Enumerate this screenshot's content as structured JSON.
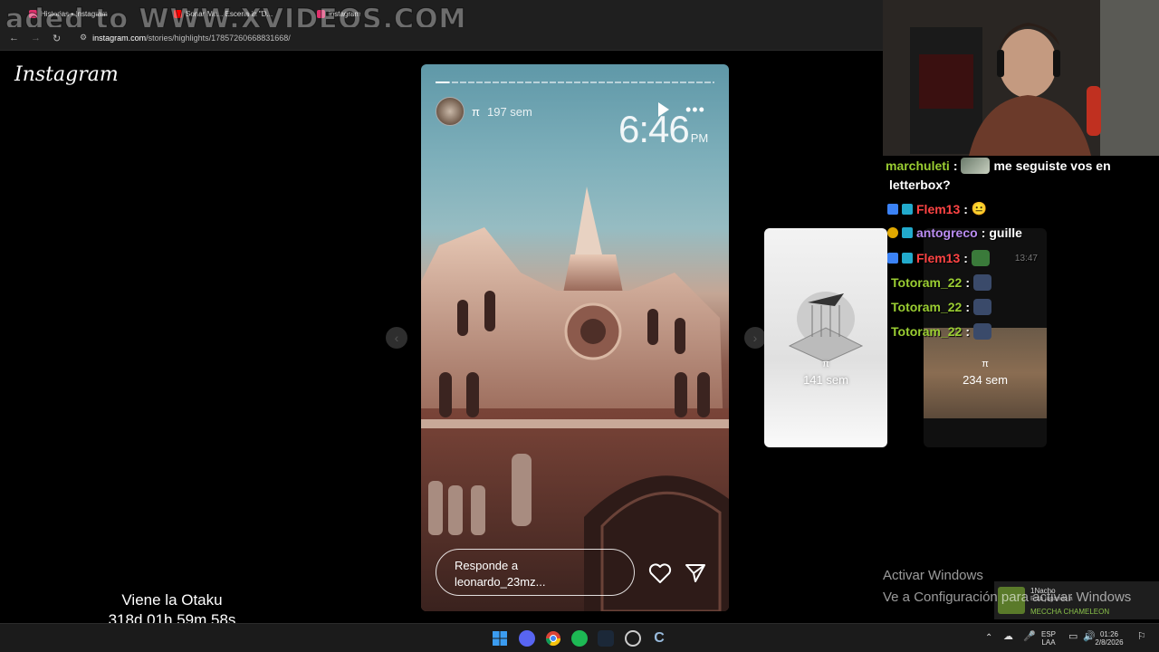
{
  "browser": {
    "tabs": [
      {
        "title": "Historias • Instagram",
        "color": "#e1306c"
      },
      {
        "title": "Sonar Mu... Escena in \"D...",
        "color": "#ff0000"
      },
      {
        "title": "instagram",
        "color": "#e1306c"
      }
    ],
    "watermark": "aded to WWW.XVIDEOS.COM",
    "url_host": "instagram.com",
    "url_path": "/stories/highlights/17857260668831668/"
  },
  "instagram": {
    "logo": "Instagram",
    "story": {
      "username": "π",
      "age": "197 sem",
      "clock_time": "6:46",
      "clock_ampm": "PM",
      "progress": 0.05,
      "reply_placeholder_line1": "Responde a",
      "reply_placeholder_line2": "leonardo_23mz..."
    },
    "side_stories": [
      {
        "username": "π",
        "age": "141 sem",
        "style": "light"
      },
      {
        "username": "π",
        "age": "234 sem",
        "style": "dark"
      }
    ]
  },
  "overlay": {
    "otaku_title": "Viene la Otaku",
    "otaku_countdown": "318d 01h 59m 58s",
    "activate_title": "Activar Windows",
    "activate_subtitle": "Ve a Configuración para activar Windows"
  },
  "chat": {
    "messages": [
      {
        "user": "marchuleti",
        "user_color": "#9acd32",
        "text": "me seguiste vos en",
        "text2": "letterbox?",
        "emote": true,
        "badges": 0
      },
      {
        "user": "Flem13",
        "user_color": "#ff4444",
        "text": "",
        "emoji": "😐",
        "badges": 2
      },
      {
        "user": "antogreco",
        "user_color": "#b98cf0",
        "text": "guille",
        "badges": 2
      },
      {
        "user": "Flem13",
        "user_color": "#ff4444",
        "text": "",
        "emote": true,
        "badges": 2,
        "time": "13:47"
      },
      {
        "user": "Totoram_22",
        "user_color": "#9acd32",
        "text": "",
        "emote": true,
        "badges": 0
      },
      {
        "user": "Totoram_22",
        "user_color": "#9acd32",
        "text": "",
        "emote": true,
        "badges": 0
      },
      {
        "user": "Totoram_22",
        "user_color": "#9acd32",
        "text": "",
        "emote": true,
        "badges": 0
      }
    ]
  },
  "now_playing": {
    "user": "1Nacho",
    "line": "Está jugando a",
    "game": "MECCHA CHAMELEON"
  },
  "taskbar": {
    "lang_top": "ESP",
    "lang_bottom": "LAA",
    "time": "01:26",
    "date": "2/8/2026"
  },
  "colors": {
    "accent_green": "#9acd32",
    "windows_blue": "#0078d4"
  }
}
